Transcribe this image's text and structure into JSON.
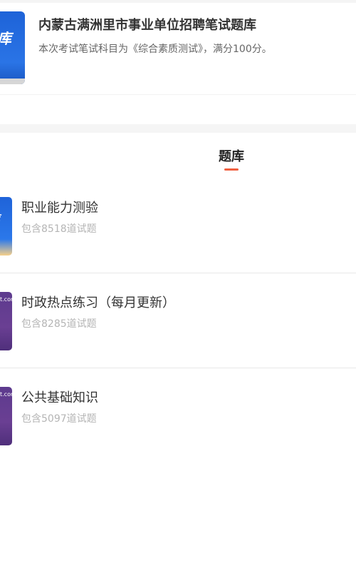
{
  "header": {
    "title": "内蒙古满洲里市事业单位招聘笔试题库",
    "description": "本次考试笔试科目为《综合素质测试》，满分100分。",
    "thumb_text": "库"
  },
  "tabs": [
    {
      "label": "题库",
      "active": true
    }
  ],
  "colors": {
    "accent": "#f06040",
    "title": "#333333",
    "muted": "#b5b5b5"
  },
  "question_banks": [
    {
      "title": "职业能力测验",
      "count": "包含8518道试题",
      "thumb_text": "库"
    },
    {
      "title": "时政热点练习（每月更新）",
      "count": "包含8285道试题",
      "thumb_text": "t.com"
    },
    {
      "title": "公共基础知识",
      "count": "包含5097道试题",
      "thumb_text": "t.com"
    }
  ]
}
